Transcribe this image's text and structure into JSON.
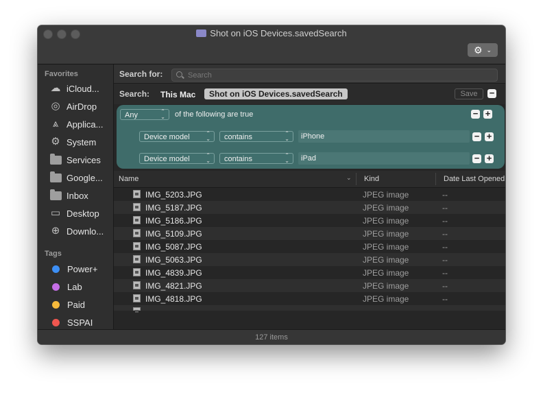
{
  "window": {
    "title": "Shot on iOS Devices.savedSearch",
    "folder_icon": "saved-search-folder-icon",
    "gear_icon": "gear-icon"
  },
  "sidebar": {
    "favorites_header": "Favorites",
    "favorites": [
      {
        "label": "iCloud...",
        "icon": "cloud-icon"
      },
      {
        "label": "AirDrop",
        "icon": "airdrop-icon"
      },
      {
        "label": "Applica...",
        "icon": "applications-icon"
      },
      {
        "label": "System",
        "icon": "gear-icon"
      },
      {
        "label": "Services",
        "icon": "folder-icon"
      },
      {
        "label": "Google...",
        "icon": "folder-icon"
      },
      {
        "label": "Inbox",
        "icon": "folder-icon"
      },
      {
        "label": "Desktop",
        "icon": "desktop-icon"
      },
      {
        "label": "Downlo...",
        "icon": "downloads-icon"
      }
    ],
    "tags_header": "Tags",
    "tags": [
      {
        "label": "Power+",
        "color": "#3d8ff5"
      },
      {
        "label": "Lab",
        "color": "#c56ee6"
      },
      {
        "label": "Paid",
        "color": "#f6b93b"
      },
      {
        "label": "SSPAI",
        "color": "#f0564f"
      }
    ]
  },
  "search": {
    "label": "Search for:",
    "placeholder": "Search"
  },
  "scope": {
    "label": "Search:",
    "this_mac": "This Mac",
    "selected": "Shot on iOS Devices.savedSearch",
    "save_label": "Save"
  },
  "criteria": {
    "match_value": "Any",
    "match_suffix": "of the following are true",
    "rules": [
      {
        "attribute": "Device model",
        "operator": "contains",
        "value": "iPhone"
      },
      {
        "attribute": "Device model",
        "operator": "contains",
        "value": "iPad"
      }
    ]
  },
  "list": {
    "columns": [
      "Name",
      "Kind",
      "Date Last Opened"
    ],
    "rows": [
      {
        "name": "IMG_5203.JPG",
        "kind": "JPEG image",
        "date": "--"
      },
      {
        "name": "IMG_5187.JPG",
        "kind": "JPEG image",
        "date": "--"
      },
      {
        "name": "IMG_5186.JPG",
        "kind": "JPEG image",
        "date": "--"
      },
      {
        "name": "IMG_5109.JPG",
        "kind": "JPEG image",
        "date": "--"
      },
      {
        "name": "IMG_5087.JPG",
        "kind": "JPEG image",
        "date": "--"
      },
      {
        "name": "IMG_5063.JPG",
        "kind": "JPEG image",
        "date": "--"
      },
      {
        "name": "IMG_4839.JPG",
        "kind": "JPEG image",
        "date": "--"
      },
      {
        "name": "IMG_4821.JPG",
        "kind": "JPEG image",
        "date": "--"
      },
      {
        "name": "IMG_4818.JPG",
        "kind": "JPEG image",
        "date": "--"
      }
    ]
  },
  "status": {
    "item_count": "127 items"
  }
}
